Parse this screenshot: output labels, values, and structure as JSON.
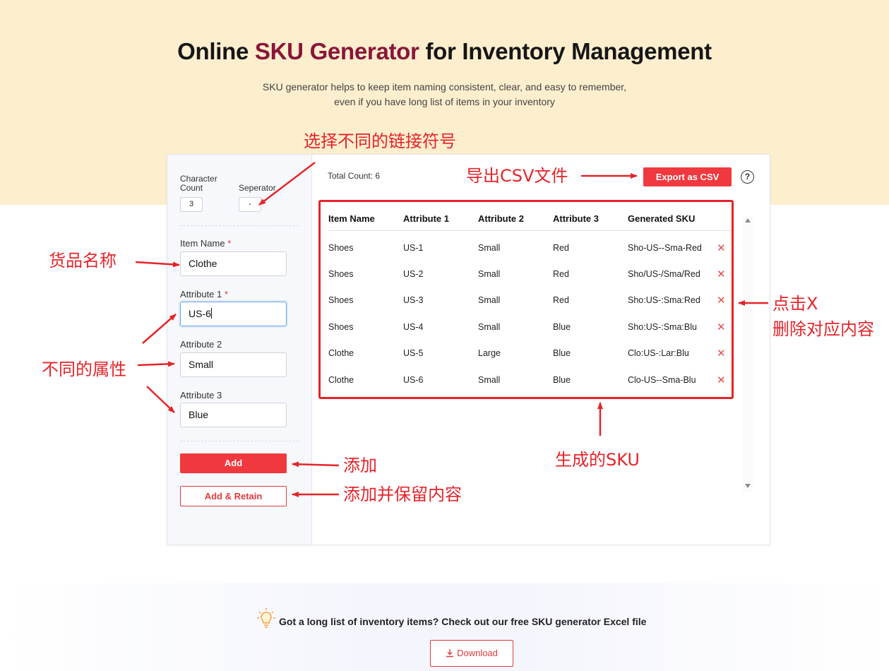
{
  "header": {
    "title_prefix": "Online ",
    "title_accent": "SKU Generator",
    "title_suffix": " for Inventory Management",
    "subtitle_line1": "SKU generator helps to keep item naming consistent, clear, and easy to remember,",
    "subtitle_line2": "even if you have long list of items in your inventory"
  },
  "settings": {
    "char_count_label_1": "Character",
    "char_count_label_2": "Count",
    "char_count_value": "3",
    "separator_label": "Seperator",
    "separator_value": "-"
  },
  "form": {
    "item_name_label": "Item Name",
    "item_name_value": "Clothe",
    "attr1_label": "Attribute 1",
    "attr1_value": "US-6",
    "attr2_label": "Attribute 2",
    "attr2_value": "Small",
    "attr3_label": "Attribute 3",
    "attr3_value": "Blue",
    "required_mark": "*",
    "add_label": "Add",
    "retain_label": "Add & Retain"
  },
  "toolbar": {
    "total_count": "Total Count: 6",
    "export_label": "Export as CSV",
    "help_label": "?"
  },
  "table": {
    "headers": [
      "Item Name",
      "Attribute 1",
      "Attribute 2",
      "Attribute 3",
      "Generated SKU"
    ],
    "delete_glyph": "✕",
    "rows": [
      [
        "Shoes",
        "US-1",
        "Small",
        "Red",
        "Sho-US--Sma-Red"
      ],
      [
        "Shoes",
        "US-2",
        "Small",
        "Red",
        "Sho/US-/Sma/Red"
      ],
      [
        "Shoes",
        "US-3",
        "Small",
        "Red",
        "Sho:US-:Sma:Red"
      ],
      [
        "Shoes",
        "US-4",
        "Small",
        "Blue",
        "Sho:US-:Sma:Blu"
      ],
      [
        "Clothe",
        "US-5",
        "Large",
        "Blue",
        "Clo:US-:Lar:Blu"
      ],
      [
        "Clothe",
        "US-6",
        "Small",
        "Blue",
        "Clo-US--Sma-Blu"
      ]
    ]
  },
  "annotations": {
    "separator": "选择不同的链接符号",
    "export": "导出CSV文件",
    "item_name": "货品名称",
    "attributes": "不同的属性",
    "delete_line1": "点击X",
    "delete_line2": "删除对应内容",
    "generated": "生成的SKU",
    "add": "添加",
    "retain": "添加并保留内容",
    "color": "#e5242a"
  },
  "footer": {
    "text": "Got a long list of inventory items? Check out our free SKU generator Excel file",
    "download_label": "Download"
  },
  "colors": {
    "hero_bg": "#fdeece",
    "accent": "#8a1538",
    "button_red": "#f0393f"
  }
}
